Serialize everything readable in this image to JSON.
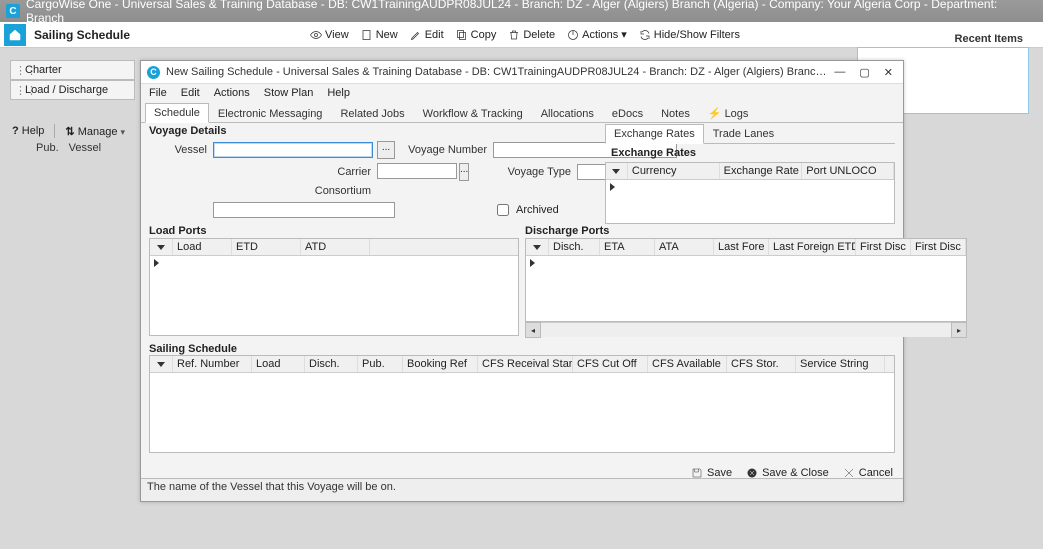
{
  "titlebar": "CargoWise One - Universal Sales & Training Database - DB: CW1TrainingAUDPR08JUL24 - Branch: DZ - Alger (Algiers) Branch (Algeria) - Company: Your Algeria Corp - Department: Branch",
  "module_title": "Sailing Schedule",
  "toolbar": {
    "view": "View",
    "new": "New",
    "edit": "Edit",
    "copy": "Copy",
    "delete": "Delete",
    "actions": "Actions",
    "hide": "Hide/Show Filters"
  },
  "recent_label": "Recent Items",
  "left": {
    "row1": "Charter",
    "row2": "Load / Discharge",
    "help": "Help",
    "manage": "Manage",
    "pub": "Pub.",
    "vessel": "Vessel"
  },
  "dialog": {
    "title": "New Sailing Schedule - Universal Sales & Training Database - DB: CW1TrainingAUDPR08JUL24 - Branch: DZ - Alger (Algiers) Branch (Algeria) - Company: Your Al...",
    "menu": {
      "file": "File",
      "edit": "Edit",
      "actions": "Actions",
      "stow": "Stow Plan",
      "help": "Help"
    },
    "tabs": {
      "schedule": "Schedule",
      "em": "Electronic Messaging",
      "rj": "Related Jobs",
      "wt": "Workflow & Tracking",
      "alloc": "Allocations",
      "edocs": "eDocs",
      "notes": "Notes",
      "logs": "Logs"
    },
    "voyage": {
      "header": "Voyage Details",
      "vessel_label": "Vessel",
      "voyage_number_label": "Voyage Number",
      "carrier_label": "Carrier",
      "voyage_type_label": "Voyage Type",
      "consortium_label": "Consortium",
      "archived_label": "Archived"
    },
    "er": {
      "tab1": "Exchange Rates",
      "tab2": "Trade Lanes",
      "header": "Exchange Rates",
      "cols": {
        "currency": "Currency",
        "rate": "Exchange Rate",
        "port": "Port UNLOCO"
      }
    },
    "load_ports": {
      "header": "Load Ports",
      "cols": {
        "load": "Load",
        "etd": "ETD",
        "atd": "ATD"
      }
    },
    "disch_ports": {
      "header": "Discharge Ports",
      "cols": {
        "disch": "Disch.",
        "eta": "ETA",
        "ata": "ATA",
        "lf": "Last Fore",
        "lfe": "Last Foreign ETD",
        "fd": "First Disc",
        "fd2": "First Disc"
      }
    },
    "sched": {
      "header": "Sailing Schedule",
      "cols": {
        "ref": "Ref. Number",
        "load": "Load",
        "disch": "Disch.",
        "pub": "Pub.",
        "bref": "Booking Ref",
        "cfsr": "CFS Receival Start",
        "cfsc": "CFS Cut Off",
        "cfsa": "CFS Available",
        "cfss": "CFS Stor.",
        "ss": "Service String"
      }
    },
    "footer": {
      "save": "Save",
      "saveclose": "Save & Close",
      "cancel": "Cancel"
    },
    "status": "The name of the Vessel that this Voyage will be on."
  }
}
